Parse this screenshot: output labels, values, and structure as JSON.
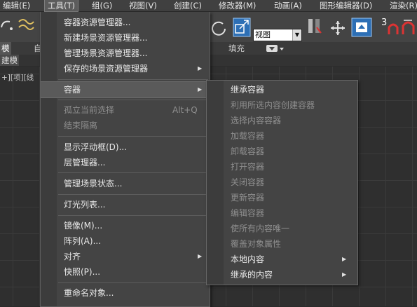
{
  "menubar": {
    "items": [
      "编辑(E)",
      "工具(T)",
      "组(G)",
      "视图(V)",
      "创建(C)",
      "修改器(M)",
      "动画(A)",
      "图形编辑器(D)",
      "渲染(R)"
    ]
  },
  "toolbar": {
    "view_dropdown": "视图",
    "snap_label": "3"
  },
  "ribbon": {
    "tabs": [
      "模",
      "自",
      "填充"
    ],
    "sub_label": "建模"
  },
  "viewport": {
    "label": "+][项][线"
  },
  "tools_menu": {
    "items": [
      {
        "label": "容器资源管理器...",
        "enabled": true
      },
      {
        "label": "新建场景资源管理器...",
        "enabled": true
      },
      {
        "label": "管理场景资源管理器...",
        "enabled": true
      },
      {
        "label": "保存的场景资源管理器",
        "enabled": true,
        "submenu": true
      },
      {
        "label": "容器",
        "enabled": true,
        "submenu": true,
        "highlighted": true
      },
      {
        "label": "孤立当前选择",
        "enabled": false,
        "shortcut": "Alt+Q"
      },
      {
        "label": "结束隔离",
        "enabled": false
      },
      {
        "label": "显示浮动框(D)...",
        "enabled": true
      },
      {
        "label": "层管理器...",
        "enabled": true
      },
      {
        "label": "管理场景状态...",
        "enabled": true
      },
      {
        "label": "灯光列表...",
        "enabled": true
      },
      {
        "label": "镜像(M)...",
        "enabled": true
      },
      {
        "label": "阵列(A)...",
        "enabled": true
      },
      {
        "label": "对齐",
        "enabled": true,
        "submenu": true
      },
      {
        "label": "快照(P)...",
        "enabled": true
      },
      {
        "label": "重命名对象...",
        "enabled": true
      }
    ]
  },
  "container_submenu": {
    "items": [
      {
        "label": "继承容器",
        "enabled": true
      },
      {
        "label": "利用所选内容创建容器",
        "enabled": false
      },
      {
        "label": "选择内容容器",
        "enabled": false
      },
      {
        "label": "加载容器",
        "enabled": false
      },
      {
        "label": "卸载容器",
        "enabled": false
      },
      {
        "label": "打开容器",
        "enabled": false
      },
      {
        "label": "关闭容器",
        "enabled": false
      },
      {
        "label": "更新容器",
        "enabled": false
      },
      {
        "label": "编辑容器",
        "enabled": false
      },
      {
        "label": "使所有内容唯一",
        "enabled": false
      },
      {
        "label": "覆盖对象属性",
        "enabled": false
      },
      {
        "label": "本地内容",
        "enabled": true,
        "submenu": true
      },
      {
        "label": "继承的内容",
        "enabled": true,
        "submenu": true
      }
    ]
  },
  "icons": [
    "undo-icon",
    "link-icon",
    "rotate-icon",
    "scale-icon",
    "mirror-icon",
    "move-icon",
    "render-setup-icon",
    "snap-icon",
    "angle-snap-icon"
  ],
  "colors": {
    "menu_bg": "#444444",
    "highlight": "#5a5a5a",
    "disabled_text": "#8e8e8e",
    "text": "#e8e8e8"
  }
}
